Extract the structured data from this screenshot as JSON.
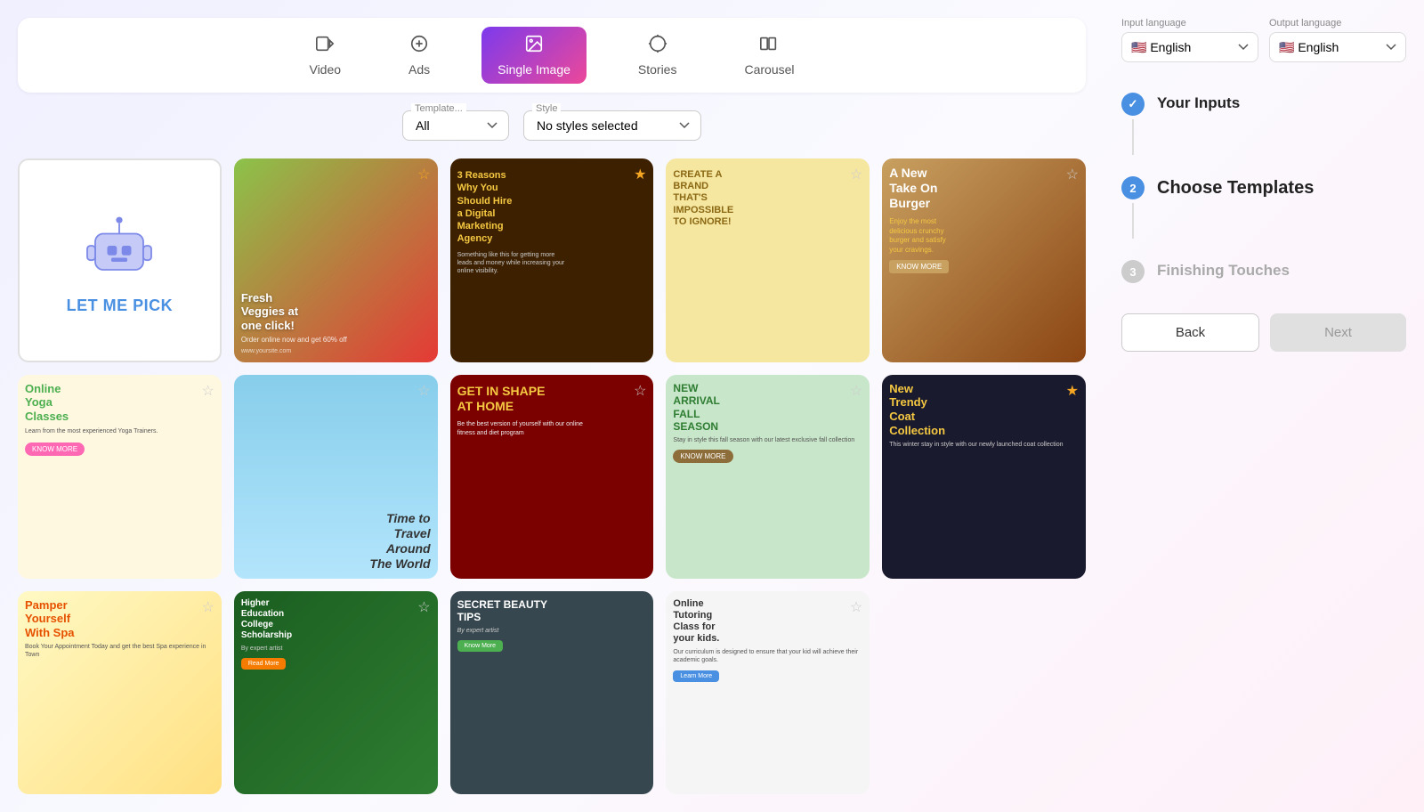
{
  "header": {
    "tabs": [
      {
        "id": "video",
        "label": "Video",
        "icon": "▶",
        "active": false
      },
      {
        "id": "ads",
        "label": "Ads",
        "icon": "◈",
        "active": false
      },
      {
        "id": "single-image",
        "label": "Single Image",
        "icon": "🖼",
        "active": true
      },
      {
        "id": "stories",
        "label": "Stories",
        "icon": "⊕",
        "active": false
      },
      {
        "id": "carousel",
        "label": "Carousel",
        "icon": "⧉",
        "active": false
      }
    ]
  },
  "filters": {
    "template_label": "Template...",
    "template_value": "All",
    "style_label": "Style",
    "style_value": "No styles selected"
  },
  "templates": [
    {
      "id": "tomatoes",
      "bg": "#e8f5e9",
      "label": "Fresh Veggies at one click!",
      "text_color": "#2e7d32",
      "has_star": true,
      "star_gold": false
    },
    {
      "id": "marketing",
      "bg": "#3e2000",
      "label": "3 Reasons Why You Should Hire a Digital Marketing Agency",
      "text_color": "#f5c842",
      "has_star": true,
      "star_gold": true
    },
    {
      "id": "brand",
      "bg": "#f5e6a0",
      "label": "CREATE A BRAND THAT'S IMPOSSIBLE TO IGNORE!",
      "text_color": "#8b6914",
      "has_star": true,
      "star_gold": false
    },
    {
      "id": "burger",
      "bg": "#c8a060",
      "label": "A New Take On Burger",
      "text_color": "#fff",
      "has_star": true,
      "star_gold": false
    },
    {
      "id": "yoga",
      "bg": "#fff8e1",
      "label": "Online Yoga Classes",
      "text_color": "#4caf50",
      "has_star": true,
      "star_gold": false
    },
    {
      "id": "travel",
      "bg": "#b3e5fc",
      "label": "Time to Travel Around The World",
      "text_color": "#555",
      "has_star": true,
      "star_gold": false
    },
    {
      "id": "fitness",
      "bg": "#7b0000",
      "label": "GET IN SHAPE AT HOME",
      "text_color": "#f5c842",
      "has_star": true,
      "star_gold": false
    },
    {
      "id": "fall",
      "bg": "#c8e6c9",
      "label": "NEW ARRIVAL FALL SEASON",
      "text_color": "#2e7d32",
      "has_star": true,
      "star_gold": false
    },
    {
      "id": "coat",
      "bg": "#1a1a2e",
      "label": "New Trendy Coat Collection",
      "text_color": "#f5c842",
      "has_star": true,
      "star_gold": true
    },
    {
      "id": "spa",
      "bg": "#fff9c4",
      "label": "Pamper Yourself With Spa",
      "text_color": "#e65100",
      "has_star": true,
      "star_gold": false
    },
    {
      "id": "scholarship",
      "bg": "#1b5e20",
      "label": "Higher Education College Scholarship",
      "text_color": "#fff",
      "has_star": true,
      "star_gold": false
    },
    {
      "id": "beauty",
      "bg": "#37474f",
      "label": "SECRET BEAUTY TIPS",
      "text_color": "#fff",
      "has_star": false,
      "star_gold": false
    },
    {
      "id": "tutoring",
      "bg": "#f5f5f5",
      "label": "Online Tutoring Class for your kids.",
      "text_color": "#333",
      "has_star": true,
      "star_gold": false
    }
  ],
  "sidebar": {
    "input_language_label": "Input language",
    "output_language_label": "Output language",
    "input_language_value": "English",
    "output_language_value": "English",
    "steps": [
      {
        "number": "✓",
        "label": "Your Inputs",
        "state": "completed"
      },
      {
        "number": "2",
        "label": "Choose Templates",
        "state": "active"
      },
      {
        "number": "3",
        "label": "Finishing Touches",
        "state": "inactive"
      }
    ],
    "back_label": "Back",
    "next_label": "Next"
  },
  "let_me_pick": {
    "label": "LET ME PICK"
  }
}
